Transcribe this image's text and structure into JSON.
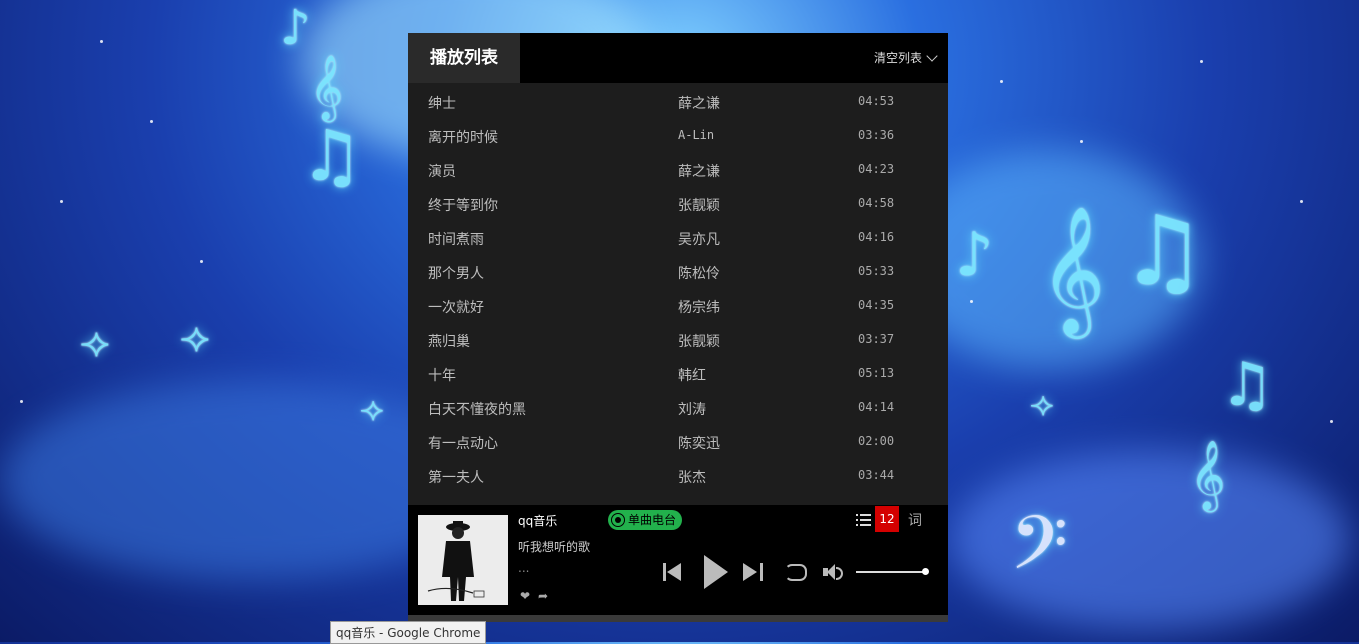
{
  "playlist": {
    "title": "播放列表",
    "clear_label": "清空列表",
    "songs": [
      {
        "title": "绅士",
        "artist": "薛之谦",
        "duration": "04:53"
      },
      {
        "title": "离开的时候",
        "artist": "A-Lin",
        "duration": "03:36"
      },
      {
        "title": "演员",
        "artist": "薛之谦",
        "duration": "04:23"
      },
      {
        "title": "终于等到你",
        "artist": "张靓颖",
        "duration": "04:58"
      },
      {
        "title": "时间煮雨",
        "artist": "吴亦凡",
        "duration": "04:16"
      },
      {
        "title": "那个男人",
        "artist": "陈松伶",
        "duration": "05:33"
      },
      {
        "title": "一次就好",
        "artist": "杨宗纬",
        "duration": "04:35"
      },
      {
        "title": "燕归巢",
        "artist": "张靓颖",
        "duration": "03:37"
      },
      {
        "title": "十年",
        "artist": "韩红",
        "duration": "05:13"
      },
      {
        "title": "白天不懂夜的黑",
        "artist": "刘涛",
        "duration": "04:14"
      },
      {
        "title": "有一点动心",
        "artist": "陈奕迅",
        "duration": "02:00"
      },
      {
        "title": "第一夫人",
        "artist": "张杰",
        "duration": "03:44"
      }
    ]
  },
  "player": {
    "song_title": "qq音乐",
    "song_subtitle": "听我想听的歌",
    "dots": "...",
    "radio_label": "单曲电台",
    "playlist_count": "12",
    "lyric_label": "词",
    "volume_level": 1.0,
    "accent_color": "#22b14c",
    "badge_color": "#d40000"
  },
  "taskbar": {
    "tooltip": "qq音乐 - Google Chrome"
  }
}
